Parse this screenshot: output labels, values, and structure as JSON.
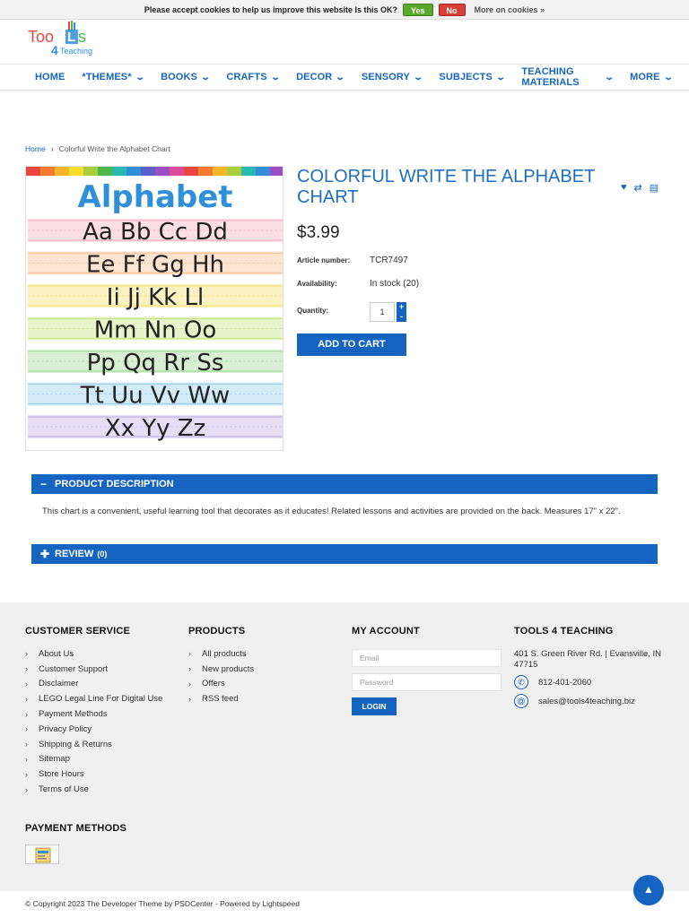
{
  "cookie": {
    "message": "Please accept cookies to help us improve this website Is this OK?",
    "yes": "Yes",
    "no": "No",
    "more": "More on cookies »"
  },
  "logo": {
    "line1": "TooLs",
    "line2": "4Teaching"
  },
  "nav": [
    {
      "label": "HOME"
    },
    {
      "label": "*THEMES*"
    },
    {
      "label": "BOOKS"
    },
    {
      "label": "CRAFTS"
    },
    {
      "label": "DECOR"
    },
    {
      "label": "SENSORY"
    },
    {
      "label": "SUBJECTS"
    },
    {
      "label": "TEACHING MATERIALS"
    },
    {
      "label": "MORE"
    }
  ],
  "breadcrumb": {
    "home": "Home",
    "current": "Colorful Write the Alphabet Chart"
  },
  "chart_image": {
    "heading": "Alphabet",
    "rows": [
      "Aa Bb Cc Dd",
      "Ee Ff Gg Hh",
      "Ii Jj Kk Ll",
      "Mm Nn Oo",
      "Pp Qq Rr Ss",
      "Tt Uu Vv Ww",
      "Xx Yy Zz"
    ],
    "row_colors": [
      "#f7b5c8",
      "#fbc49a",
      "#f5e27a",
      "#c9e58a",
      "#a8dca0",
      "#9dd0ee",
      "#c7b6e6"
    ],
    "top_stripe_colors": [
      "#e8473e",
      "#f47a2d",
      "#f7b52a",
      "#f7dd2e",
      "#a8cf3a",
      "#4db848",
      "#2ab9b0",
      "#2f8fd8",
      "#5b5fc7",
      "#9b4fc2",
      "#e04a9a",
      "#e8473e",
      "#f47a2d",
      "#f7b52a",
      "#a8cf3a",
      "#2ab9b0",
      "#2f8fd8",
      "#9b4fc2"
    ]
  },
  "product": {
    "title": "COLORFUL WRITE THE ALPHABET CHART",
    "price": "$3.99",
    "article_label": "Article number:",
    "article_value": "TCR7497",
    "availability_label": "Availability:",
    "availability_value": "In stock (20)",
    "quantity_label": "Quantity:",
    "quantity_value": "1",
    "add_to_cart": "ADD TO CART"
  },
  "description": {
    "tab_label": "PRODUCT DESCRIPTION",
    "text": "This chart is a convenient, useful learning tool that decorates as it educates! Related lessons and activities are provided on the back. Measures 17\" x 22\"."
  },
  "review": {
    "tab_label": "REVIEW",
    "count": "(0)"
  },
  "footer": {
    "customer_service": {
      "title": "CUSTOMER SERVICE",
      "items": [
        "About Us",
        "Customer Support",
        "Disclaimer",
        "LEGO Legal Line For Digital Use",
        "Payment Methods",
        "Privacy Policy",
        "Shipping & Returns",
        "Sitemap",
        "Store Hours",
        "Terms of Use"
      ]
    },
    "products": {
      "title": "PRODUCTS",
      "items": [
        "All products",
        "New products",
        "Offers",
        "RSS feed"
      ]
    },
    "account": {
      "title": "MY ACCOUNT",
      "email_placeholder": "Email",
      "password_placeholder": "Password",
      "login": "LOGIN"
    },
    "company": {
      "title": "TOOLS 4 TEACHING",
      "address": "401 S. Green River Rd. | Evansville, IN 47715",
      "phone": "812-401-2060",
      "email": "sales@tools4teaching.biz"
    },
    "payment_title": "PAYMENT METHODS",
    "copyright": "© Copyright 2023 The Developer Theme by PSDCenter - Powered by Lightspeed"
  },
  "colors": {
    "accent": "#1565c0",
    "footer_bg": "#f0f0f0"
  }
}
